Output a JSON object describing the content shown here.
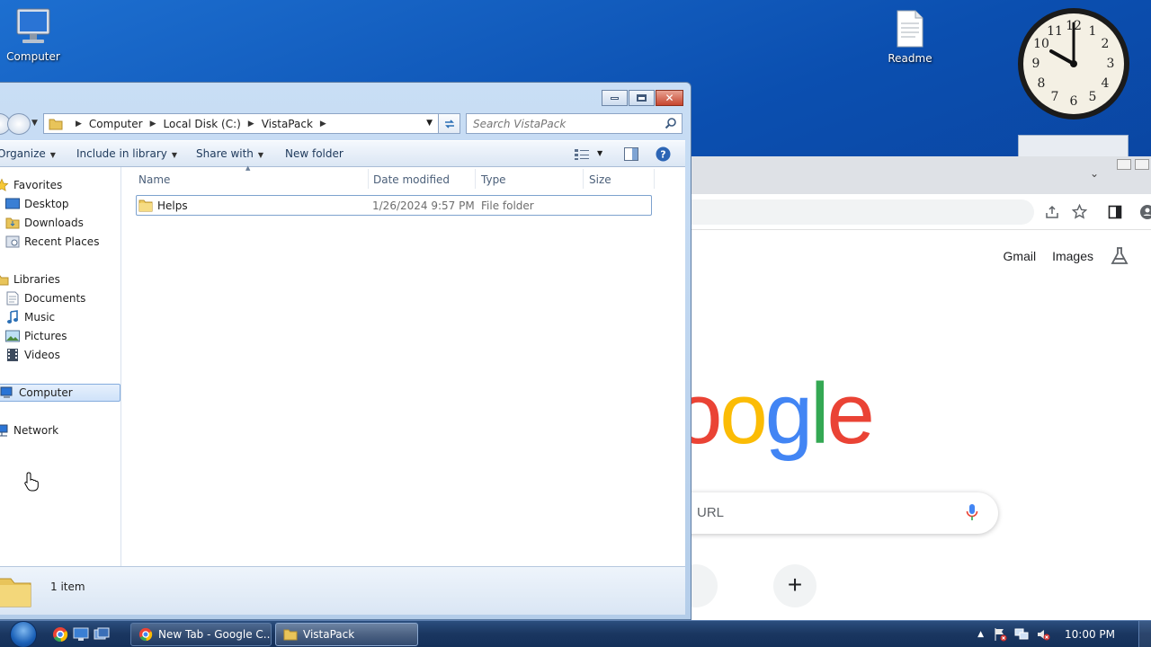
{
  "desktop": {
    "icons": [
      {
        "label": "Computer"
      },
      {
        "label": "Readme"
      }
    ]
  },
  "chrome": {
    "header_links": {
      "gmail": "Gmail",
      "images": "Images"
    },
    "logo_visible_text": [
      "o",
      "o",
      "g",
      "l",
      "e"
    ],
    "logo_colors": [
      "#ea4335",
      "#fbbc05",
      "#4285f4",
      "#34a853",
      "#ea4335"
    ],
    "search_placeholder": "URL",
    "shortcut_add": "+"
  },
  "explorer": {
    "breadcrumb": [
      "Computer",
      "Local Disk (C:)",
      "VistaPack"
    ],
    "search_placeholder": "Search VistaPack",
    "commands": {
      "organize": "Organize",
      "include": "Include in library",
      "share": "Share with",
      "new_folder": "New folder"
    },
    "nav": {
      "favorites": "Favorites",
      "desktop": "Desktop",
      "downloads": "Downloads",
      "recent": "Recent Places",
      "libraries": "Libraries",
      "documents": "Documents",
      "music": "Music",
      "pictures": "Pictures",
      "videos": "Videos",
      "computer": "Computer",
      "network": "Network"
    },
    "columns": {
      "name": "Name",
      "date": "Date modified",
      "type": "Type",
      "size": "Size"
    },
    "files": [
      {
        "name": "Helps",
        "date": "1/26/2024 9:57 PM",
        "type": "File folder",
        "size": ""
      }
    ],
    "status": "1 item"
  },
  "taskbar": {
    "tasks": [
      {
        "label": "New Tab - Google C..."
      },
      {
        "label": "VistaPack"
      }
    ],
    "clock": "10:00 PM"
  },
  "colors": {
    "accent": "#1d6fd0",
    "selection_border": "#7da2ce",
    "chrome_blue": "#4285f4"
  }
}
